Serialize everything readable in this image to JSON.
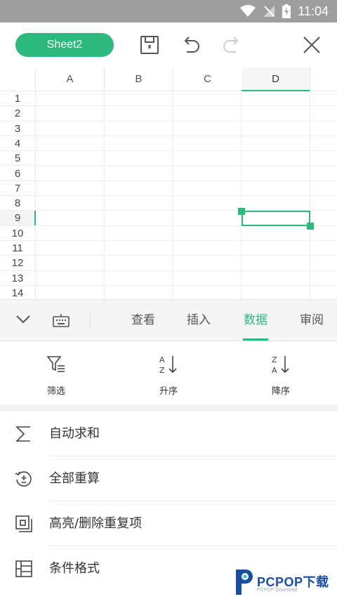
{
  "status_bar": {
    "time": "11:04"
  },
  "toolbar": {
    "sheet_name": "Sheet2"
  },
  "grid": {
    "columns": [
      "A",
      "B",
      "C",
      "D"
    ],
    "rows": [
      "1",
      "2",
      "3",
      "4",
      "5",
      "6",
      "7",
      "8",
      "9",
      "10",
      "11",
      "12",
      "13",
      "14"
    ],
    "selected_column": "D",
    "selected_row": "9"
  },
  "tabs": [
    {
      "label": "查看",
      "active": false
    },
    {
      "label": "插入",
      "active": false
    },
    {
      "label": "数据",
      "active": true
    },
    {
      "label": "审阅",
      "active": false
    }
  ],
  "tools": [
    {
      "label": "筛选",
      "icon": "filter-icon"
    },
    {
      "label": "升序",
      "icon": "sort-ascending-icon"
    },
    {
      "label": "降序",
      "icon": "sort-descending-icon"
    }
  ],
  "list": [
    {
      "label": "自动求和",
      "icon": "sigma-icon"
    },
    {
      "label": "全部重算",
      "icon": "recalculate-icon"
    },
    {
      "label": "高亮/删除重复项",
      "icon": "duplicate-highlight-icon"
    },
    {
      "label": "条件格式",
      "icon": "conditional-format-icon"
    }
  ],
  "watermark": {
    "brand": "PCPOP下载",
    "sub": "PCPOP Download"
  },
  "colors": {
    "accent": "#2db87d",
    "status_bar": "#9e9e9e"
  }
}
